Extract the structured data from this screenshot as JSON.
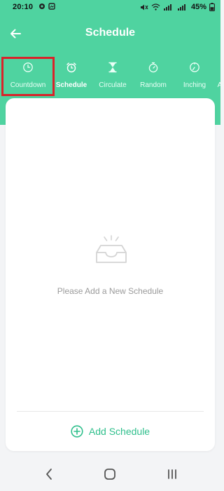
{
  "status_bar": {
    "time": "20:10",
    "battery": "45%"
  },
  "header": {
    "title": "Schedule"
  },
  "tabs": [
    {
      "label": "Countdown",
      "icon": "clock-icon"
    },
    {
      "label": "Schedule",
      "icon": "alarm-icon",
      "active": true
    },
    {
      "label": "Circulate",
      "icon": "hourglass-icon"
    },
    {
      "label": "Random",
      "icon": "stopwatch-icon"
    },
    {
      "label": "Inching",
      "icon": "timer-icon"
    },
    {
      "label": "A",
      "icon": ""
    }
  ],
  "empty_state": {
    "icon": "empty-inbox-icon",
    "message": "Please Add a New Schedule"
  },
  "actions": {
    "add_schedule_label": "Add Schedule"
  },
  "colors": {
    "brand_green": "#4fd3a0",
    "accent_green": "#2fbf8c",
    "highlight_red": "#d9232a",
    "card_bg": "#ffffff",
    "page_bg": "#f3f4f6"
  },
  "nav_bar": {
    "icons": [
      "back-nav-icon",
      "home-nav-icon",
      "recents-nav-icon"
    ]
  }
}
